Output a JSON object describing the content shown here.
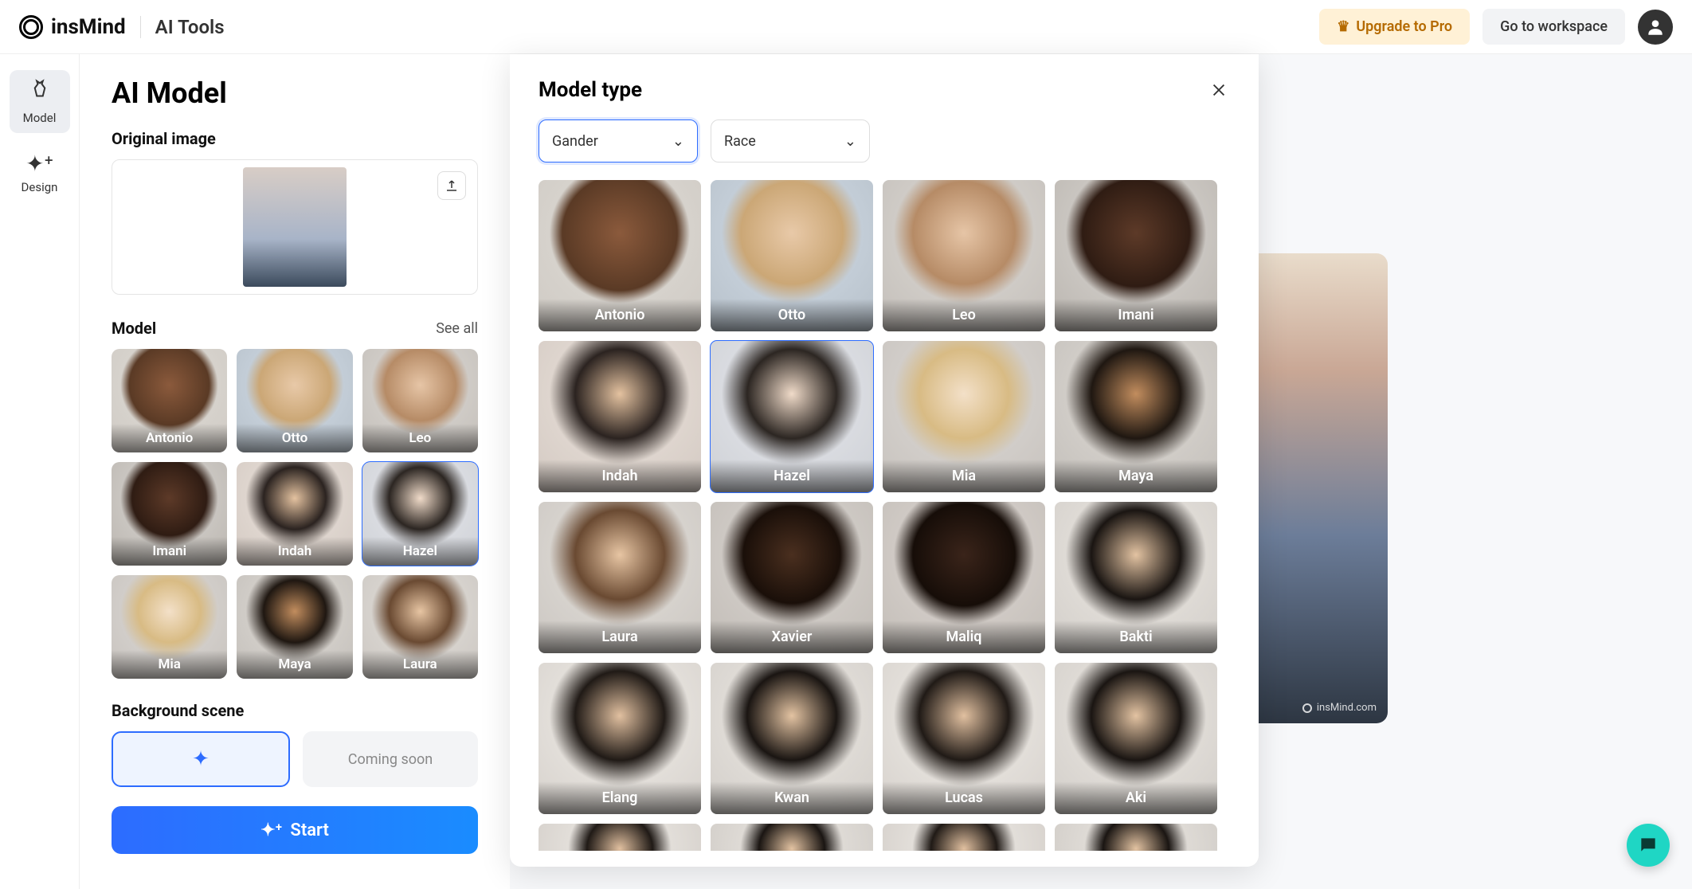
{
  "header": {
    "logo_text": "insMind",
    "section": "AI Tools",
    "upgrade": "Upgrade to Pro",
    "workspace": "Go to workspace"
  },
  "rail": {
    "model": "Model",
    "design": "Design"
  },
  "panel": {
    "title": "AI Model",
    "original_label": "Original image",
    "model_label": "Model",
    "see_all": "See all",
    "models": [
      {
        "name": "Antonio",
        "cls": "f-a"
      },
      {
        "name": "Otto",
        "cls": "f-b"
      },
      {
        "name": "Leo",
        "cls": "f-c"
      },
      {
        "name": "Imani",
        "cls": "f-d"
      },
      {
        "name": "Indah",
        "cls": "f-e"
      },
      {
        "name": "Hazel",
        "cls": "f-f",
        "selected": true
      },
      {
        "name": "Mia",
        "cls": "f-g"
      },
      {
        "name": "Maya",
        "cls": "f-h"
      },
      {
        "name": "Laura",
        "cls": "f-i"
      }
    ],
    "bg_label": "Background scene",
    "bg_coming": "Coming soon",
    "start": "Start"
  },
  "modal": {
    "title": "Model type",
    "filter_gender": "Gander",
    "filter_race": "Race",
    "models": [
      {
        "name": "Antonio",
        "cls": "f-a"
      },
      {
        "name": "Otto",
        "cls": "f-b"
      },
      {
        "name": "Leo",
        "cls": "f-c"
      },
      {
        "name": "Imani",
        "cls": "f-d"
      },
      {
        "name": "Indah",
        "cls": "f-e"
      },
      {
        "name": "Hazel",
        "cls": "f-f",
        "selected": true
      },
      {
        "name": "Mia",
        "cls": "f-g"
      },
      {
        "name": "Maya",
        "cls": "f-h"
      },
      {
        "name": "Laura",
        "cls": "f-i"
      },
      {
        "name": "Xavier",
        "cls": "f-j"
      },
      {
        "name": "Maliq",
        "cls": "f-k"
      },
      {
        "name": "Bakti",
        "cls": "f-l"
      },
      {
        "name": "Elang",
        "cls": "f-m"
      },
      {
        "name": "Kwan",
        "cls": "f-l"
      },
      {
        "name": "Lucas",
        "cls": "f-m"
      },
      {
        "name": "Aki",
        "cls": "f-l"
      }
    ]
  },
  "preview": {
    "watermark": "insMind.com"
  }
}
